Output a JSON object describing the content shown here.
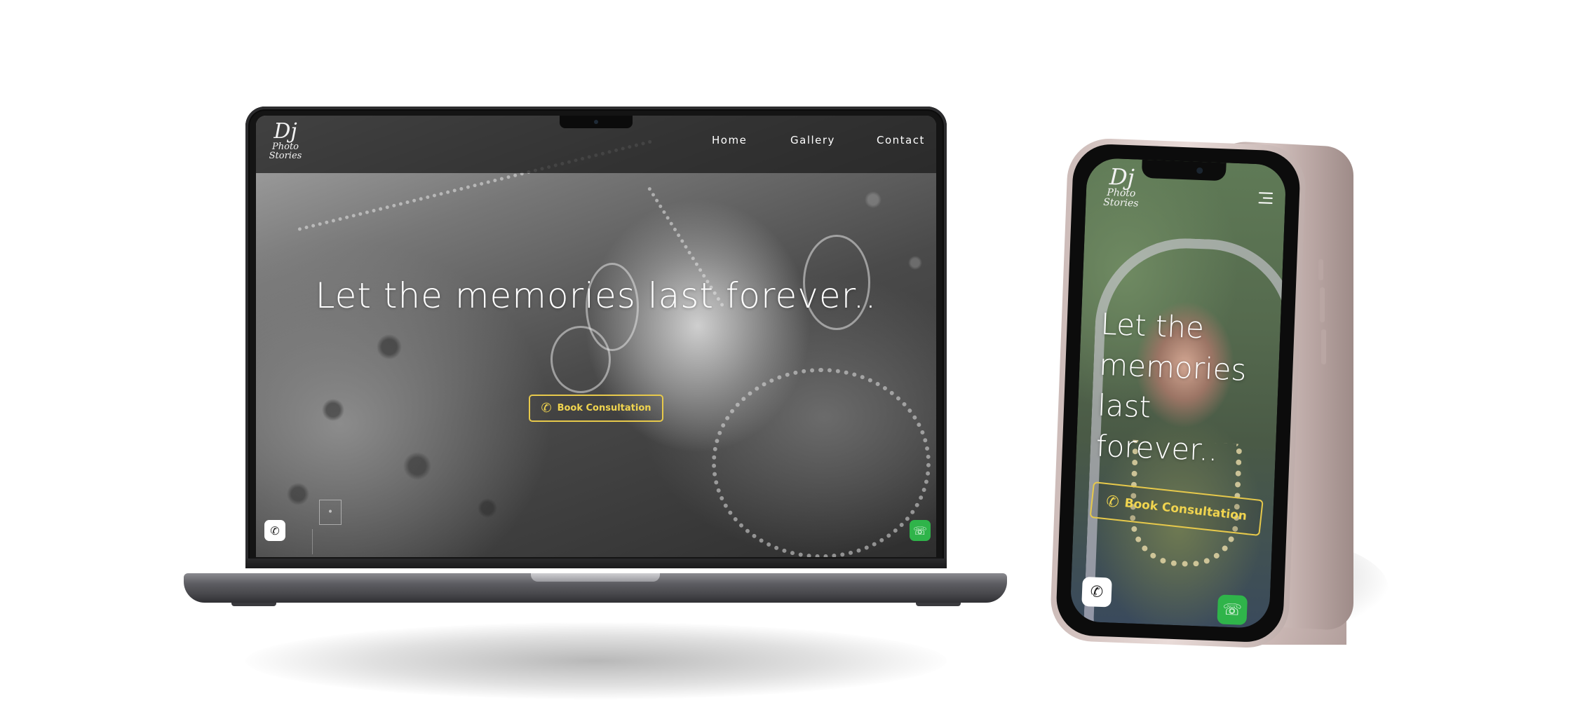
{
  "laptop": {
    "logo": {
      "mark": "Dj",
      "name": "Photo Stories"
    },
    "nav": [
      {
        "label": "Home"
      },
      {
        "label": "Gallery"
      },
      {
        "label": "Contact"
      }
    ],
    "hero_title": "Let the memories last forever..",
    "cta_label": "Book Consultation",
    "icons": {
      "cta": "phone-icon",
      "call": "phone-icon",
      "whatsapp": "whatsapp-icon",
      "menu": "hamburger-icon"
    }
  },
  "phone": {
    "logo": {
      "mark": "Dj",
      "name": "Photo Stories"
    },
    "hero_lines": [
      "Let the",
      "memories",
      "last forever.."
    ],
    "cta_label": "Book Consultation"
  },
  "colors": {
    "accent": "#f0d44f",
    "whatsapp": "#2fb44a",
    "nav_bg": "#191919",
    "device_gray": "#5d5d62",
    "phone_pink": "#e9dbd8"
  }
}
